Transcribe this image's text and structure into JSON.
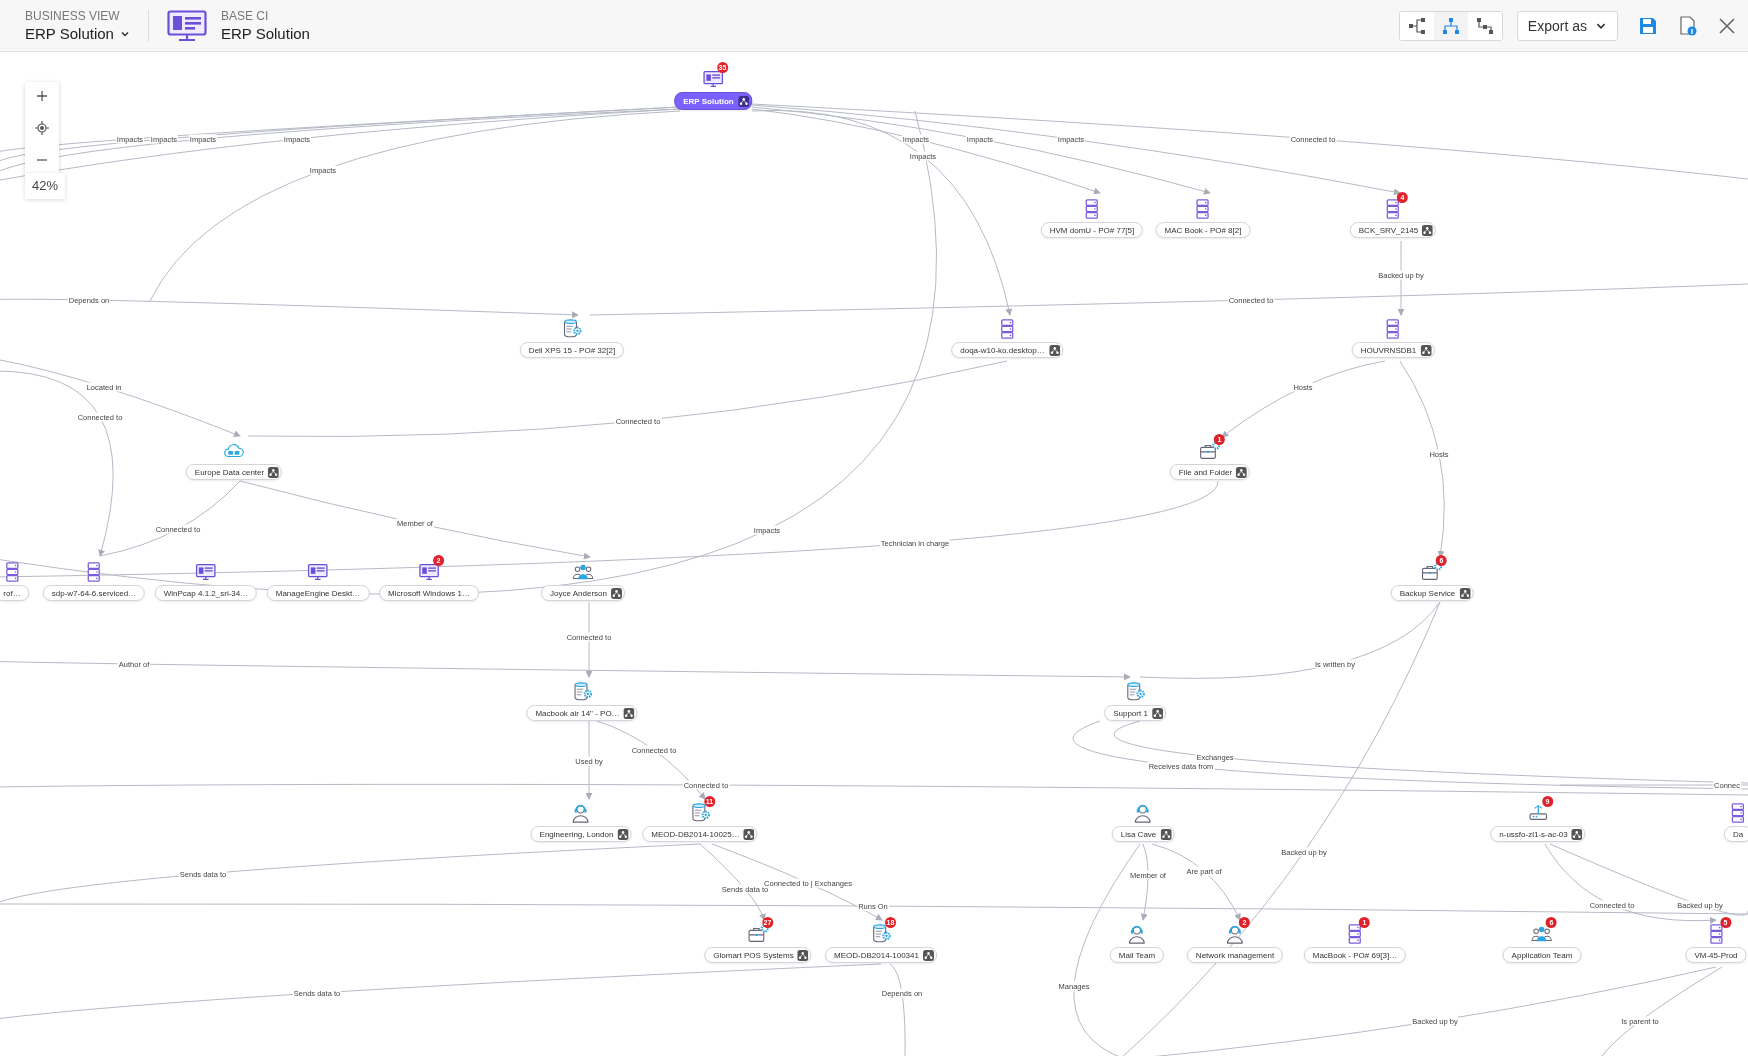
{
  "header": {
    "view_label": "BUSINESS VIEW",
    "view_name": "ERP Solution",
    "ci_label": "BASE CI",
    "ci_name": "ERP Solution",
    "layouts": [
      {
        "kind": "horizontal",
        "selected": false
      },
      {
        "kind": "vertical",
        "selected": true
      },
      {
        "kind": "branch",
        "selected": false
      }
    ],
    "export_label": "Export as"
  },
  "zoom": {
    "level_text": "42%"
  },
  "nodes": [
    {
      "label": "ERP Solution",
      "kind": "monitor",
      "badge": "35",
      "actions": true,
      "selected": true
    },
    {
      "label": "HVM domU - PO# 77[5]",
      "kind": "server",
      "actions": false,
      "selected": false
    },
    {
      "label": "MAC Book - PO# 8[2]",
      "kind": "server",
      "actions": false,
      "selected": false
    },
    {
      "label": "BCK_SRV_2145",
      "kind": "server",
      "badge": "4",
      "actions": true,
      "selected": false
    },
    {
      "label": "Dell XPS 15 - PO# 32[2]",
      "kind": "dbgear",
      "actions": false,
      "selected": false
    },
    {
      "label": "doqa-w10-ko.desktop…",
      "kind": "server",
      "actions": true,
      "selected": false
    },
    {
      "label": "HOUVRNSDB1",
      "kind": "server",
      "actions": true,
      "selected": false
    },
    {
      "label": "Europe Data center",
      "kind": "cloud",
      "actions": true,
      "selected": false
    },
    {
      "label": "File and Folder",
      "kind": "briefcase",
      "badge": "1",
      "actions": true,
      "selected": false
    },
    {
      "label": "rof…",
      "kind": "server",
      "actions": false,
      "selected": false
    },
    {
      "label": "sdp-w7-64-6.serviced…",
      "kind": "server",
      "actions": false,
      "selected": false
    },
    {
      "label": "WinPcap 4.1.2_sri-34…",
      "kind": "monitor",
      "actions": false,
      "selected": false
    },
    {
      "label": "ManageEngine Deskt…",
      "kind": "monitor",
      "actions": false,
      "selected": false
    },
    {
      "label": "Microsoft Windows 1…",
      "kind": "monitor",
      "badge": "2",
      "actions": false,
      "selected": false
    },
    {
      "label": "Joyce Anderson",
      "kind": "people",
      "actions": true,
      "selected": false
    },
    {
      "label": "Backup Service",
      "kind": "briefcase",
      "badge": "6",
      "actions": true,
      "selected": false
    },
    {
      "label": "Support 1",
      "kind": "dbgear",
      "actions": true,
      "selected": false
    },
    {
      "label": "Macbook air 14\" - PO…",
      "kind": "dbgear",
      "actions": true,
      "selected": false
    },
    {
      "label": "Engineering, London",
      "kind": "headset",
      "actions": true,
      "selected": false
    },
    {
      "label": "MEOD-DB2014-10025…",
      "kind": "dbgear",
      "badge": "11",
      "actions": true,
      "selected": false
    },
    {
      "label": "Lisa Cave",
      "kind": "headset",
      "actions": true,
      "selected": false
    },
    {
      "label": "n-ussfo-zl1-s-ac-03",
      "kind": "router",
      "badge": "9",
      "actions": true,
      "selected": false
    },
    {
      "label": "Da",
      "kind": "server",
      "actions": false,
      "selected": false
    },
    {
      "label": "Glomart POS Systems",
      "kind": "briefcase",
      "badge": "27",
      "actions": true,
      "selected": false
    },
    {
      "label": "MEOD-DB2014-100341",
      "kind": "dbgear",
      "badge": "18",
      "actions": true,
      "selected": false
    },
    {
      "label": "Mail Team",
      "kind": "headset",
      "actions": false,
      "selected": false
    },
    {
      "label": "Network management",
      "kind": "headset",
      "badge": "2",
      "actions": false,
      "selected": false
    },
    {
      "label": "MacBook - PO# 69[3]…",
      "kind": "server",
      "badge": "1",
      "actions": false,
      "selected": false
    },
    {
      "label": "Application Team",
      "kind": "people",
      "badge": "6",
      "actions": false,
      "selected": false
    },
    {
      "label": "VM-45-Prod",
      "kind": "server",
      "badge": "5",
      "actions": false,
      "selected": false
    }
  ],
  "edges": [
    {
      "label": "Impacts"
    },
    {
      "label": "Impacts"
    },
    {
      "label": "Impacts"
    },
    {
      "label": "Impacts"
    },
    {
      "label": "Impacts"
    },
    {
      "label": "Impacts"
    },
    {
      "label": "Impacts"
    },
    {
      "label": "Impacts"
    },
    {
      "label": "Connected to"
    },
    {
      "label": "Impacts"
    },
    {
      "label": "Depends on"
    },
    {
      "label": "Connected to"
    },
    {
      "label": "Backed up by"
    },
    {
      "label": "Located in"
    },
    {
      "label": "Connected to"
    },
    {
      "label": "Connected to"
    },
    {
      "label": "Hosts"
    },
    {
      "label": "Hosts"
    },
    {
      "label": "Connected to"
    },
    {
      "label": "Member of"
    },
    {
      "label": "Impacts"
    },
    {
      "label": "Technician in charge"
    },
    {
      "label": "Author of"
    },
    {
      "label": "Is written by"
    },
    {
      "label": "Connected to"
    },
    {
      "label": "Used by"
    },
    {
      "label": "Connected to"
    },
    {
      "label": "Connected to"
    },
    {
      "label": "Exchanges"
    },
    {
      "label": "Receives data from"
    },
    {
      "label": "Connec"
    },
    {
      "label": "Sends data to"
    },
    {
      "label": "Sends data to"
    },
    {
      "label": "Connected to | Exchanges"
    },
    {
      "label": "Runs On"
    },
    {
      "label": "Member of"
    },
    {
      "label": "Are part of"
    },
    {
      "label": "Backed up by"
    },
    {
      "label": "Connected to"
    },
    {
      "label": "Backed up by"
    },
    {
      "label": "Sends data to"
    },
    {
      "label": "Depends on"
    },
    {
      "label": "Manages"
    },
    {
      "label": "Backed up by"
    },
    {
      "label": "Is parent to"
    }
  ]
}
